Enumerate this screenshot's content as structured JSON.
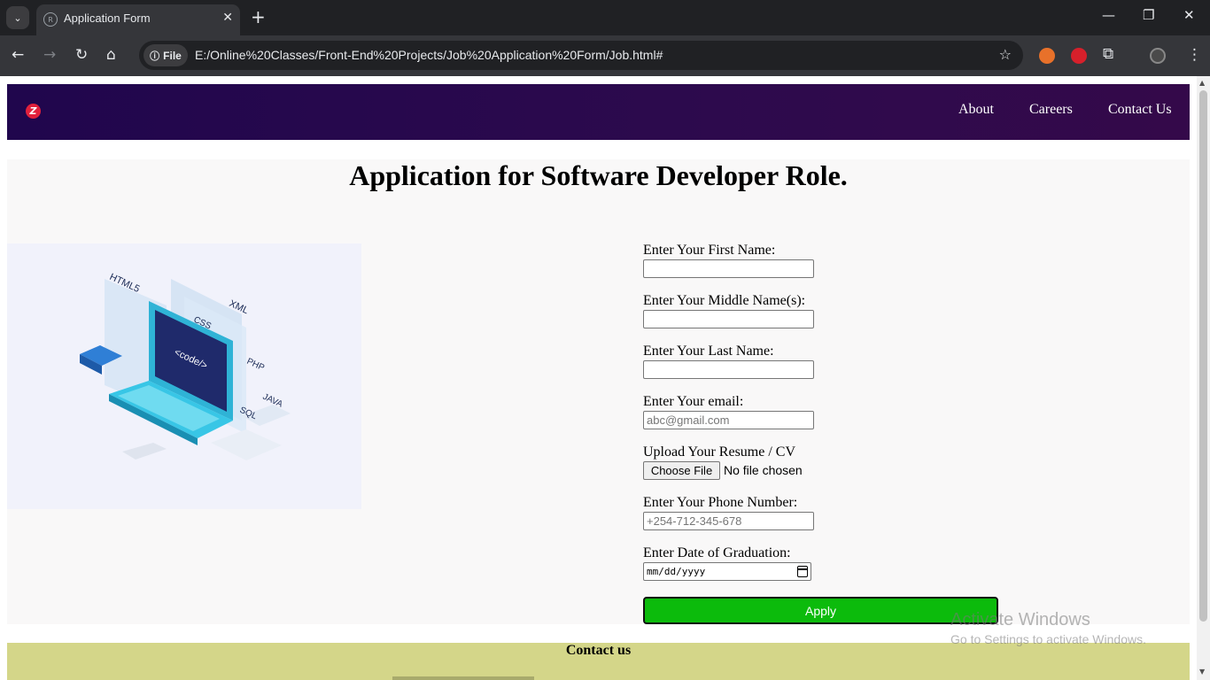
{
  "browser": {
    "tab_title": "Application Form",
    "url": "E:/Online%20Classes/Front-End%20Projects/Job%20Application%20Form/Job.html#",
    "site_chip_label": "File"
  },
  "navbar": {
    "links": [
      "About",
      "Careers",
      "Contact Us"
    ],
    "brand_color": "#2a0850",
    "logo_color": "#e0203c"
  },
  "page": {
    "heading": "Application for Software Developer Role.",
    "hero_image_labels": [
      "HTML5",
      "CSS",
      "XML",
      "PHP",
      "JAVA",
      "SQL",
      "<code/>"
    ]
  },
  "form": {
    "first_name_label": "Enter Your First Name:",
    "middle_name_label": "Enter Your Middle Name(s):",
    "last_name_label": "Enter Your Last Name:",
    "email_label": "Enter Your email:",
    "email_placeholder": "abc@gmail.com",
    "resume_label": "Upload Your Resume / CV",
    "choose_file_label": "Choose File",
    "file_status": "No file chosen",
    "phone_label": "Enter Your Phone Number:",
    "phone_placeholder": "+254-712-345-678",
    "graduation_label": "Enter Date of Graduation:",
    "date_placeholder": "mm/dd/yyyy",
    "apply_label": "Apply",
    "apply_color": "#0cbb0c"
  },
  "footer": {
    "title": "Contact us",
    "color": "#d4d689"
  },
  "os_watermark": {
    "line1": "Activate Windows",
    "line2": "Go to Settings to activate Windows."
  }
}
